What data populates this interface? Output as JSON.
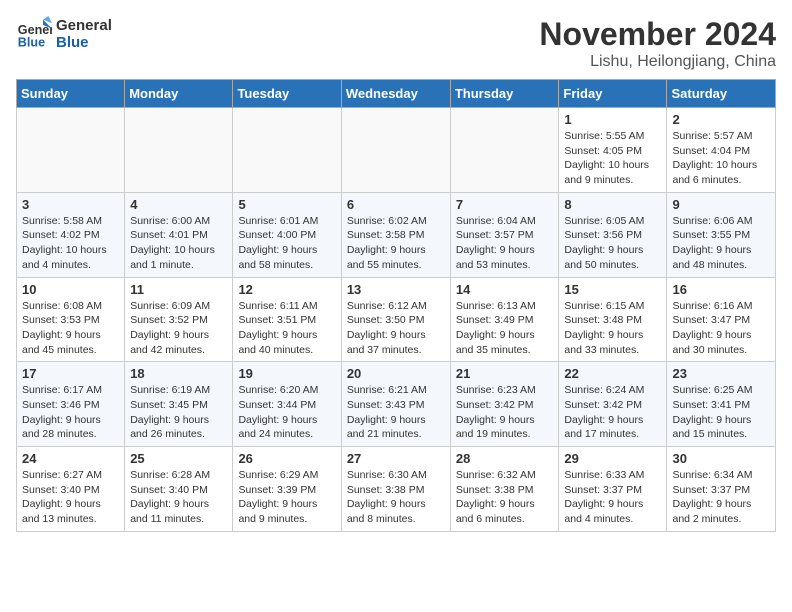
{
  "header": {
    "logo_line1": "General",
    "logo_line2": "Blue",
    "month": "November 2024",
    "location": "Lishu, Heilongjiang, China"
  },
  "days_of_week": [
    "Sunday",
    "Monday",
    "Tuesday",
    "Wednesday",
    "Thursday",
    "Friday",
    "Saturday"
  ],
  "weeks": [
    [
      {
        "day": "",
        "info": ""
      },
      {
        "day": "",
        "info": ""
      },
      {
        "day": "",
        "info": ""
      },
      {
        "day": "",
        "info": ""
      },
      {
        "day": "",
        "info": ""
      },
      {
        "day": "1",
        "info": "Sunrise: 5:55 AM\nSunset: 4:05 PM\nDaylight: 10 hours and 9 minutes."
      },
      {
        "day": "2",
        "info": "Sunrise: 5:57 AM\nSunset: 4:04 PM\nDaylight: 10 hours and 6 minutes."
      }
    ],
    [
      {
        "day": "3",
        "info": "Sunrise: 5:58 AM\nSunset: 4:02 PM\nDaylight: 10 hours and 4 minutes."
      },
      {
        "day": "4",
        "info": "Sunrise: 6:00 AM\nSunset: 4:01 PM\nDaylight: 10 hours and 1 minute."
      },
      {
        "day": "5",
        "info": "Sunrise: 6:01 AM\nSunset: 4:00 PM\nDaylight: 9 hours and 58 minutes."
      },
      {
        "day": "6",
        "info": "Sunrise: 6:02 AM\nSunset: 3:58 PM\nDaylight: 9 hours and 55 minutes."
      },
      {
        "day": "7",
        "info": "Sunrise: 6:04 AM\nSunset: 3:57 PM\nDaylight: 9 hours and 53 minutes."
      },
      {
        "day": "8",
        "info": "Sunrise: 6:05 AM\nSunset: 3:56 PM\nDaylight: 9 hours and 50 minutes."
      },
      {
        "day": "9",
        "info": "Sunrise: 6:06 AM\nSunset: 3:55 PM\nDaylight: 9 hours and 48 minutes."
      }
    ],
    [
      {
        "day": "10",
        "info": "Sunrise: 6:08 AM\nSunset: 3:53 PM\nDaylight: 9 hours and 45 minutes."
      },
      {
        "day": "11",
        "info": "Sunrise: 6:09 AM\nSunset: 3:52 PM\nDaylight: 9 hours and 42 minutes."
      },
      {
        "day": "12",
        "info": "Sunrise: 6:11 AM\nSunset: 3:51 PM\nDaylight: 9 hours and 40 minutes."
      },
      {
        "day": "13",
        "info": "Sunrise: 6:12 AM\nSunset: 3:50 PM\nDaylight: 9 hours and 37 minutes."
      },
      {
        "day": "14",
        "info": "Sunrise: 6:13 AM\nSunset: 3:49 PM\nDaylight: 9 hours and 35 minutes."
      },
      {
        "day": "15",
        "info": "Sunrise: 6:15 AM\nSunset: 3:48 PM\nDaylight: 9 hours and 33 minutes."
      },
      {
        "day": "16",
        "info": "Sunrise: 6:16 AM\nSunset: 3:47 PM\nDaylight: 9 hours and 30 minutes."
      }
    ],
    [
      {
        "day": "17",
        "info": "Sunrise: 6:17 AM\nSunset: 3:46 PM\nDaylight: 9 hours and 28 minutes."
      },
      {
        "day": "18",
        "info": "Sunrise: 6:19 AM\nSunset: 3:45 PM\nDaylight: 9 hours and 26 minutes."
      },
      {
        "day": "19",
        "info": "Sunrise: 6:20 AM\nSunset: 3:44 PM\nDaylight: 9 hours and 24 minutes."
      },
      {
        "day": "20",
        "info": "Sunrise: 6:21 AM\nSunset: 3:43 PM\nDaylight: 9 hours and 21 minutes."
      },
      {
        "day": "21",
        "info": "Sunrise: 6:23 AM\nSunset: 3:42 PM\nDaylight: 9 hours and 19 minutes."
      },
      {
        "day": "22",
        "info": "Sunrise: 6:24 AM\nSunset: 3:42 PM\nDaylight: 9 hours and 17 minutes."
      },
      {
        "day": "23",
        "info": "Sunrise: 6:25 AM\nSunset: 3:41 PM\nDaylight: 9 hours and 15 minutes."
      }
    ],
    [
      {
        "day": "24",
        "info": "Sunrise: 6:27 AM\nSunset: 3:40 PM\nDaylight: 9 hours and 13 minutes."
      },
      {
        "day": "25",
        "info": "Sunrise: 6:28 AM\nSunset: 3:40 PM\nDaylight: 9 hours and 11 minutes."
      },
      {
        "day": "26",
        "info": "Sunrise: 6:29 AM\nSunset: 3:39 PM\nDaylight: 9 hours and 9 minutes."
      },
      {
        "day": "27",
        "info": "Sunrise: 6:30 AM\nSunset: 3:38 PM\nDaylight: 9 hours and 8 minutes."
      },
      {
        "day": "28",
        "info": "Sunrise: 6:32 AM\nSunset: 3:38 PM\nDaylight: 9 hours and 6 minutes."
      },
      {
        "day": "29",
        "info": "Sunrise: 6:33 AM\nSunset: 3:37 PM\nDaylight: 9 hours and 4 minutes."
      },
      {
        "day": "30",
        "info": "Sunrise: 6:34 AM\nSunset: 3:37 PM\nDaylight: 9 hours and 2 minutes."
      }
    ]
  ]
}
